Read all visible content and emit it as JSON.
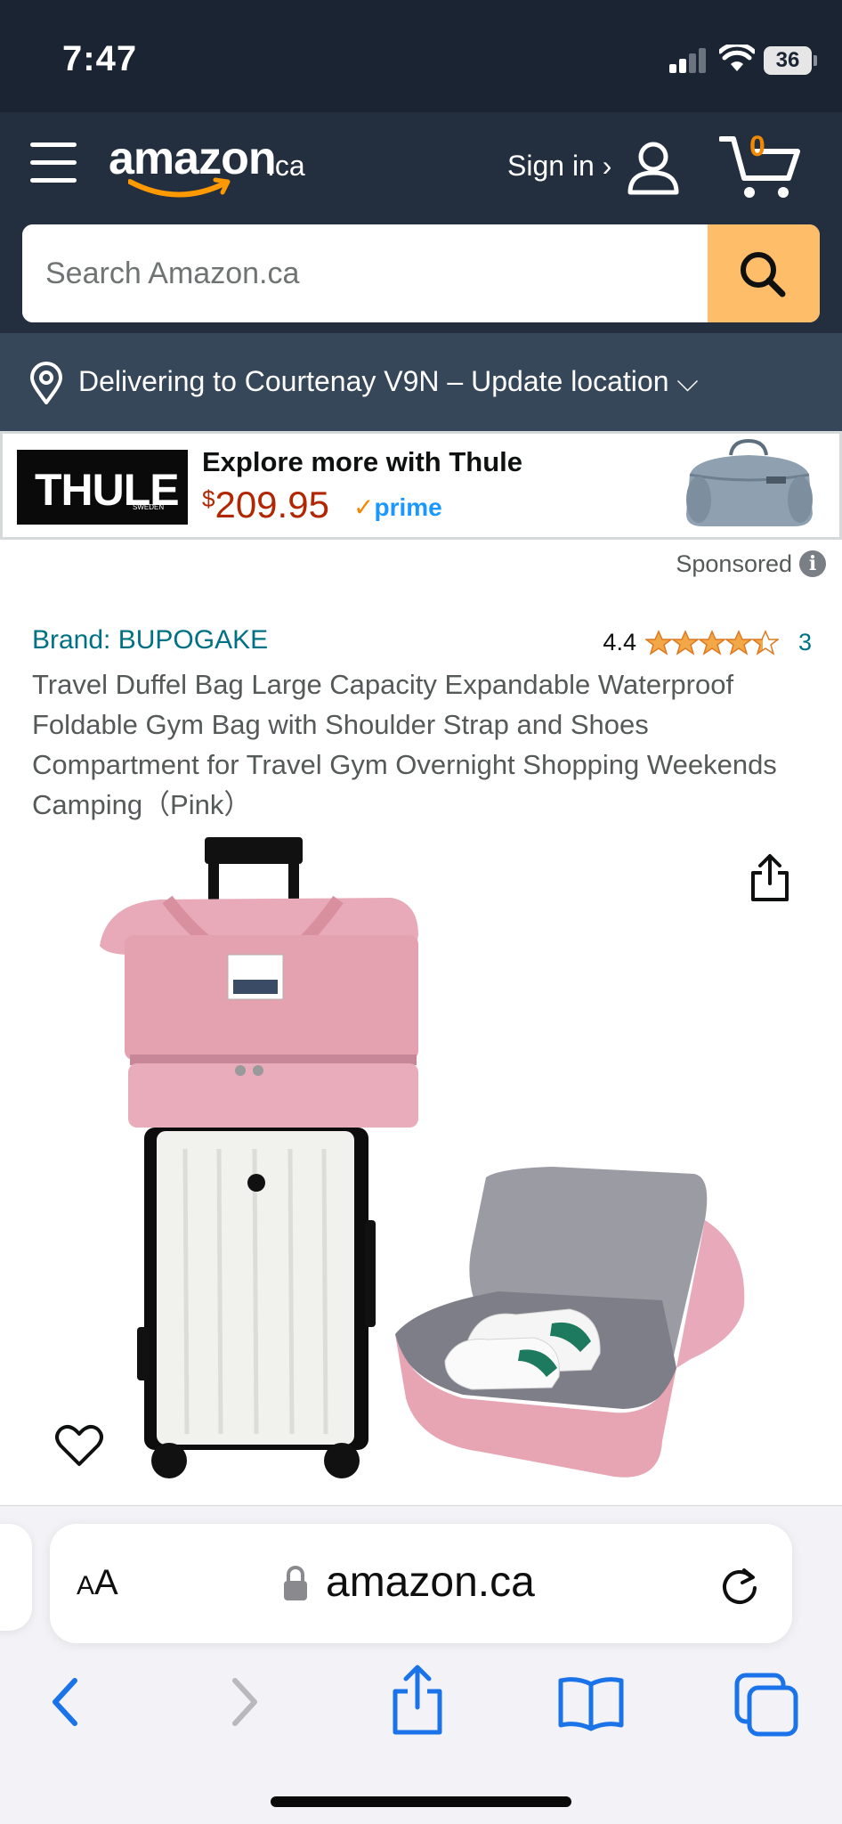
{
  "status_bar": {
    "time": "7:47",
    "battery": "36"
  },
  "header": {
    "logo_text": "amazon",
    "logo_suffix": ".ca",
    "sign_in": "Sign in ›",
    "cart_count": "0",
    "search_placeholder": "Search Amazon.ca",
    "brand_color": "#232f3e",
    "accent_color": "#febd69"
  },
  "location": {
    "text": "Delivering to Courtenay V9N – Update location ⌵"
  },
  "ad": {
    "logo_text": "THULE",
    "logo_sub": "SWEDEN",
    "title": "Explore more with Thule",
    "price_symbol": "$",
    "price": "209.95",
    "prime_check": "✓",
    "prime_label": "prime",
    "sponsored": "Sponsored",
    "info_glyph": "i"
  },
  "product": {
    "brand": "Brand: BUPOGAKE",
    "rating": "4.4",
    "rating_stars": 4.4,
    "rating_count": "3",
    "title": "Travel Duffel Bag Large Capacity Expandable Waterproof Foldable Gym Bag with Shoulder Strap and Shoes Compartment for Travel Gym Overnight Shopping Weekends Camping（Pink）"
  },
  "safari": {
    "aa_label_big": "A",
    "aa_label_small": "A",
    "url": "amazon.ca"
  }
}
